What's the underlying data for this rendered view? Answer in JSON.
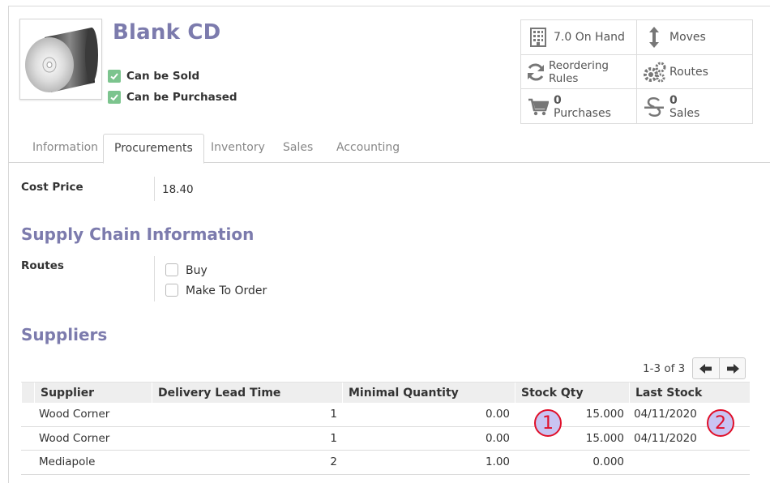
{
  "product": {
    "title": "Blank CD",
    "flags": [
      {
        "label": "Can be Sold",
        "checked": true
      },
      {
        "label": "Can be Purchased",
        "checked": true
      }
    ]
  },
  "stat_buttons": [
    {
      "icon": "building-icon",
      "label": "7.0 On Hand"
    },
    {
      "icon": "arrows-vertical-icon",
      "label": "Moves"
    },
    {
      "icon": "refresh-icon",
      "label": "Reordering Rules"
    },
    {
      "icon": "gears-icon",
      "label": "Routes"
    },
    {
      "icon": "shopping-cart-icon",
      "count": "0",
      "label": "Purchases"
    },
    {
      "icon": "strikethrough-icon",
      "count": "0",
      "label": "Sales"
    }
  ],
  "tabs": [
    "Information",
    "Procurements",
    "Inventory",
    "Sales",
    "Accounting"
  ],
  "active_tab": "Procurements",
  "cost_price": {
    "label": "Cost Price",
    "value": "18.40"
  },
  "supply_chain": {
    "title": "Supply Chain Information",
    "routes_label": "Routes",
    "routes": [
      {
        "label": "Buy",
        "checked": false
      },
      {
        "label": "Make To Order",
        "checked": false
      }
    ]
  },
  "suppliers": {
    "title": "Suppliers",
    "pager": "1-3 of 3",
    "columns": [
      "Supplier",
      "Delivery Lead Time",
      "Minimal Quantity",
      "Stock Qty",
      "Last Stock"
    ],
    "rows": [
      [
        "Wood Corner",
        "1",
        "0.00",
        "15.000",
        "04/11/2020"
      ],
      [
        "Wood Corner",
        "1",
        "0.00",
        "15.000",
        "04/11/2020"
      ],
      [
        "Mediapole",
        "2",
        "1.00",
        "0.000",
        ""
      ]
    ]
  },
  "markers": [
    "1",
    "2"
  ],
  "colors": {
    "accent": "#7c7bad",
    "check": "#7cc48e",
    "marker_border": "#e0102a",
    "marker_fill": "#c9c4f2"
  }
}
